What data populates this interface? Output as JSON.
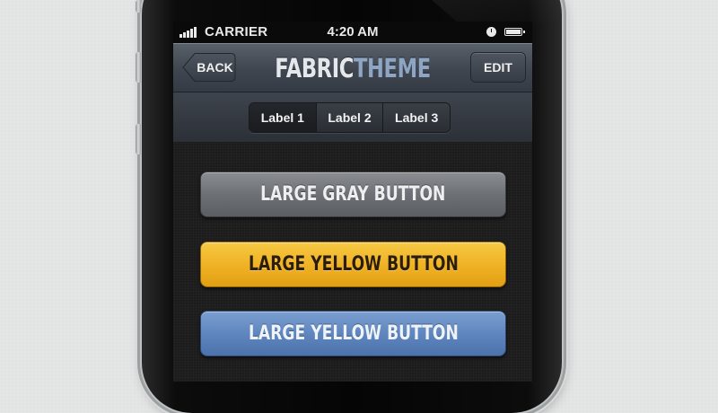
{
  "status_bar": {
    "carrier": "CARRIER",
    "time": "4:20 AM",
    "icons": [
      "signal-icon",
      "clock-icon",
      "battery-icon"
    ]
  },
  "nav_bar": {
    "back_label": "BACK",
    "title_part1": "FABRIC",
    "title_part2": "THEME",
    "edit_label": "EDIT"
  },
  "segmented_control": {
    "labels": [
      "Label 1",
      "Label 2",
      "Label 3"
    ],
    "selected_index": 0
  },
  "buttons": [
    {
      "label": "LARGE GRAY BUTTON",
      "color": "#6d7074"
    },
    {
      "label": "LARGE YELLOW BUTTON",
      "color": "#f0b326"
    },
    {
      "label": "LARGE YELLOW BUTTON",
      "color": "#5f86bf"
    }
  ],
  "colors": {
    "title_accent": "#8ea6c4",
    "background": "#e4e5e5"
  }
}
